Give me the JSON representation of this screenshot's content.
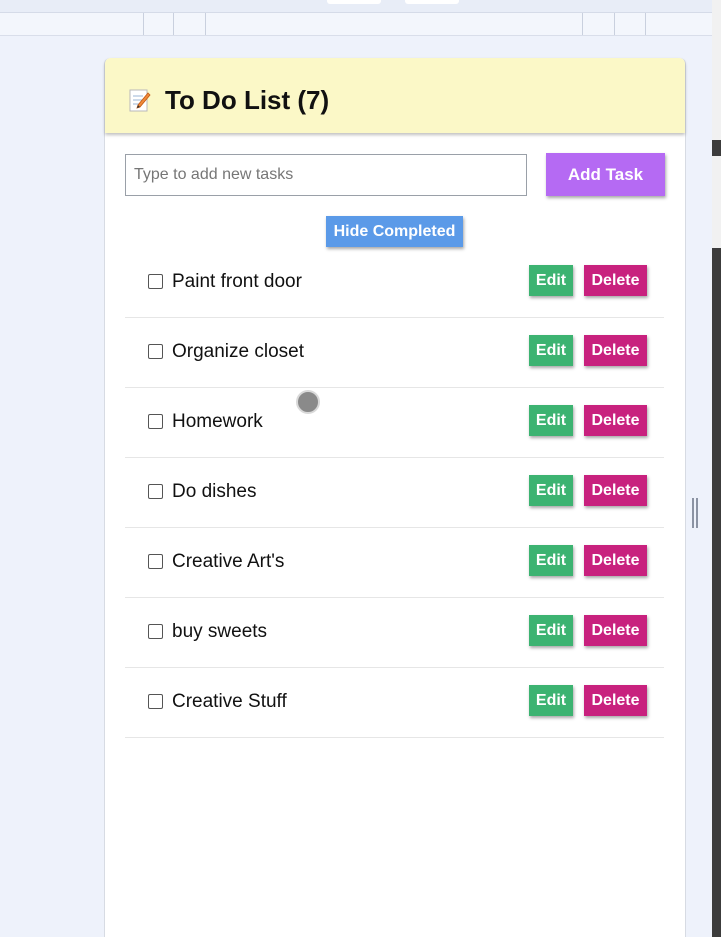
{
  "header": {
    "title": "To Do List (7)",
    "icon": "memo-icon"
  },
  "input": {
    "placeholder": "Type to add new tasks",
    "value": ""
  },
  "buttons": {
    "add_task": "Add Task",
    "hide_completed": "Hide Completed",
    "edit": "Edit",
    "delete": "Delete"
  },
  "tasks": [
    {
      "label": "Paint front door",
      "completed": false
    },
    {
      "label": "Organize closet",
      "completed": false
    },
    {
      "label": "Homework",
      "completed": false
    },
    {
      "label": "Do dishes",
      "completed": false
    },
    {
      "label": "Creative Art's",
      "completed": false
    },
    {
      "label": "buy sweets",
      "completed": false
    },
    {
      "label": "Creative Stuff",
      "completed": false
    }
  ],
  "colors": {
    "header_bg": "#fbf8c7",
    "add_task": "#b56af3",
    "hide_completed": "#5b9ae8",
    "edit": "#3cb371",
    "delete": "#c8217e"
  }
}
